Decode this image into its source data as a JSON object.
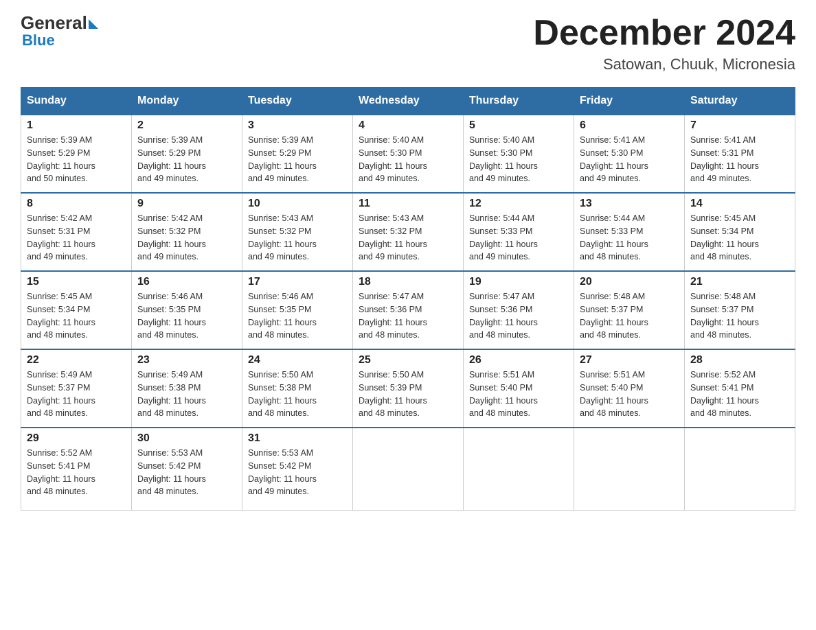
{
  "logo": {
    "general": "General",
    "blue": "Blue"
  },
  "title": "December 2024",
  "subtitle": "Satowan, Chuuk, Micronesia",
  "days_header": [
    "Sunday",
    "Monday",
    "Tuesday",
    "Wednesday",
    "Thursday",
    "Friday",
    "Saturday"
  ],
  "weeks": [
    [
      {
        "day": "1",
        "sunrise": "5:39 AM",
        "sunset": "5:29 PM",
        "daylight": "11 hours and 50 minutes."
      },
      {
        "day": "2",
        "sunrise": "5:39 AM",
        "sunset": "5:29 PM",
        "daylight": "11 hours and 49 minutes."
      },
      {
        "day": "3",
        "sunrise": "5:39 AM",
        "sunset": "5:29 PM",
        "daylight": "11 hours and 49 minutes."
      },
      {
        "day": "4",
        "sunrise": "5:40 AM",
        "sunset": "5:30 PM",
        "daylight": "11 hours and 49 minutes."
      },
      {
        "day": "5",
        "sunrise": "5:40 AM",
        "sunset": "5:30 PM",
        "daylight": "11 hours and 49 minutes."
      },
      {
        "day": "6",
        "sunrise": "5:41 AM",
        "sunset": "5:30 PM",
        "daylight": "11 hours and 49 minutes."
      },
      {
        "day": "7",
        "sunrise": "5:41 AM",
        "sunset": "5:31 PM",
        "daylight": "11 hours and 49 minutes."
      }
    ],
    [
      {
        "day": "8",
        "sunrise": "5:42 AM",
        "sunset": "5:31 PM",
        "daylight": "11 hours and 49 minutes."
      },
      {
        "day": "9",
        "sunrise": "5:42 AM",
        "sunset": "5:32 PM",
        "daylight": "11 hours and 49 minutes."
      },
      {
        "day": "10",
        "sunrise": "5:43 AM",
        "sunset": "5:32 PM",
        "daylight": "11 hours and 49 minutes."
      },
      {
        "day": "11",
        "sunrise": "5:43 AM",
        "sunset": "5:32 PM",
        "daylight": "11 hours and 49 minutes."
      },
      {
        "day": "12",
        "sunrise": "5:44 AM",
        "sunset": "5:33 PM",
        "daylight": "11 hours and 49 minutes."
      },
      {
        "day": "13",
        "sunrise": "5:44 AM",
        "sunset": "5:33 PM",
        "daylight": "11 hours and 48 minutes."
      },
      {
        "day": "14",
        "sunrise": "5:45 AM",
        "sunset": "5:34 PM",
        "daylight": "11 hours and 48 minutes."
      }
    ],
    [
      {
        "day": "15",
        "sunrise": "5:45 AM",
        "sunset": "5:34 PM",
        "daylight": "11 hours and 48 minutes."
      },
      {
        "day": "16",
        "sunrise": "5:46 AM",
        "sunset": "5:35 PM",
        "daylight": "11 hours and 48 minutes."
      },
      {
        "day": "17",
        "sunrise": "5:46 AM",
        "sunset": "5:35 PM",
        "daylight": "11 hours and 48 minutes."
      },
      {
        "day": "18",
        "sunrise": "5:47 AM",
        "sunset": "5:36 PM",
        "daylight": "11 hours and 48 minutes."
      },
      {
        "day": "19",
        "sunrise": "5:47 AM",
        "sunset": "5:36 PM",
        "daylight": "11 hours and 48 minutes."
      },
      {
        "day": "20",
        "sunrise": "5:48 AM",
        "sunset": "5:37 PM",
        "daylight": "11 hours and 48 minutes."
      },
      {
        "day": "21",
        "sunrise": "5:48 AM",
        "sunset": "5:37 PM",
        "daylight": "11 hours and 48 minutes."
      }
    ],
    [
      {
        "day": "22",
        "sunrise": "5:49 AM",
        "sunset": "5:37 PM",
        "daylight": "11 hours and 48 minutes."
      },
      {
        "day": "23",
        "sunrise": "5:49 AM",
        "sunset": "5:38 PM",
        "daylight": "11 hours and 48 minutes."
      },
      {
        "day": "24",
        "sunrise": "5:50 AM",
        "sunset": "5:38 PM",
        "daylight": "11 hours and 48 minutes."
      },
      {
        "day": "25",
        "sunrise": "5:50 AM",
        "sunset": "5:39 PM",
        "daylight": "11 hours and 48 minutes."
      },
      {
        "day": "26",
        "sunrise": "5:51 AM",
        "sunset": "5:40 PM",
        "daylight": "11 hours and 48 minutes."
      },
      {
        "day": "27",
        "sunrise": "5:51 AM",
        "sunset": "5:40 PM",
        "daylight": "11 hours and 48 minutes."
      },
      {
        "day": "28",
        "sunrise": "5:52 AM",
        "sunset": "5:41 PM",
        "daylight": "11 hours and 48 minutes."
      }
    ],
    [
      {
        "day": "29",
        "sunrise": "5:52 AM",
        "sunset": "5:41 PM",
        "daylight": "11 hours and 48 minutes."
      },
      {
        "day": "30",
        "sunrise": "5:53 AM",
        "sunset": "5:42 PM",
        "daylight": "11 hours and 48 minutes."
      },
      {
        "day": "31",
        "sunrise": "5:53 AM",
        "sunset": "5:42 PM",
        "daylight": "11 hours and 49 minutes."
      },
      null,
      null,
      null,
      null
    ]
  ],
  "labels": {
    "sunrise": "Sunrise:",
    "sunset": "Sunset:",
    "daylight": "Daylight:"
  }
}
